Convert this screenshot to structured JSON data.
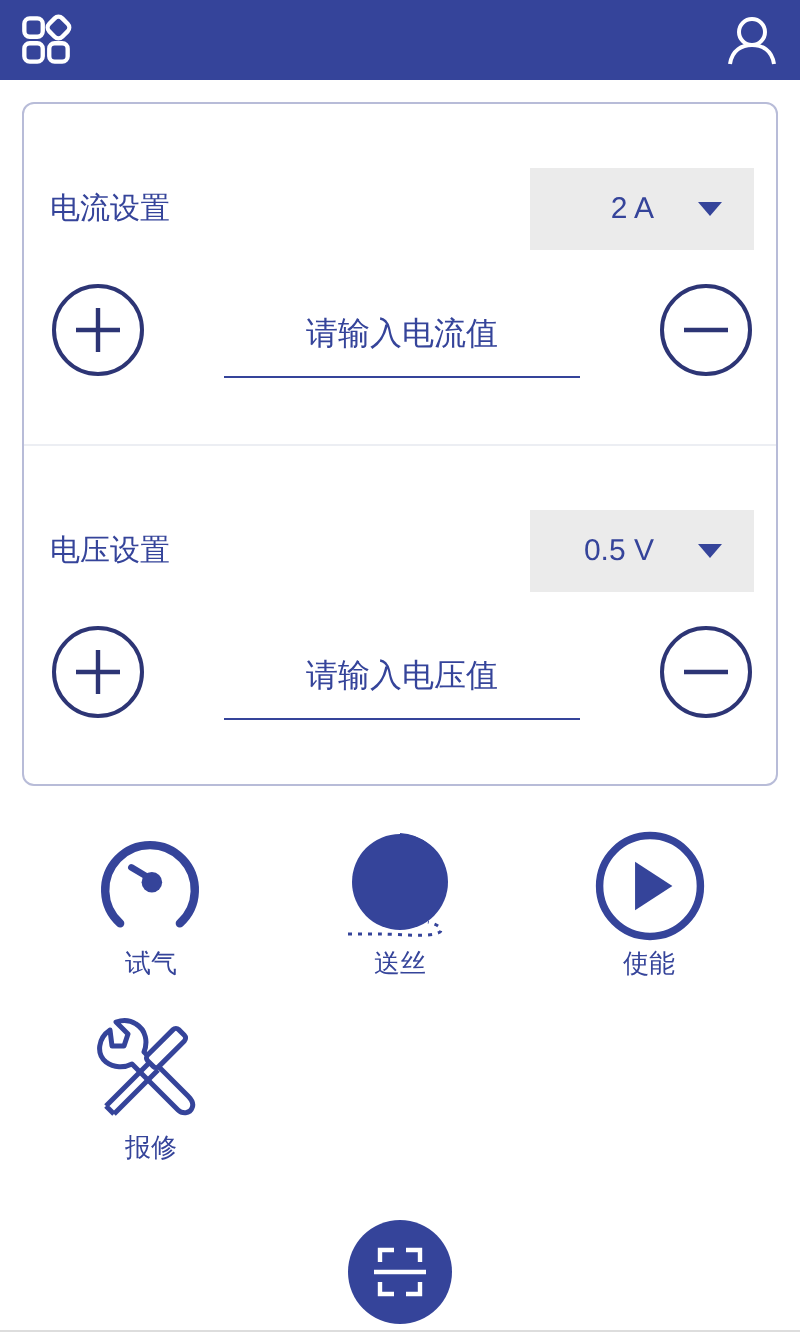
{
  "settings": [
    {
      "label": "电流设置",
      "value": "2 A",
      "placeholder": "请输入电流值"
    },
    {
      "label": "电压设置",
      "value": "0.5 V",
      "placeholder": "请输入电压值"
    }
  ],
  "actions": [
    {
      "kind": "gauge",
      "label": "试气"
    },
    {
      "kind": "spool",
      "label": "送丝"
    },
    {
      "kind": "play",
      "label": "使能"
    },
    {
      "kind": "repair",
      "label": "报修"
    }
  ]
}
